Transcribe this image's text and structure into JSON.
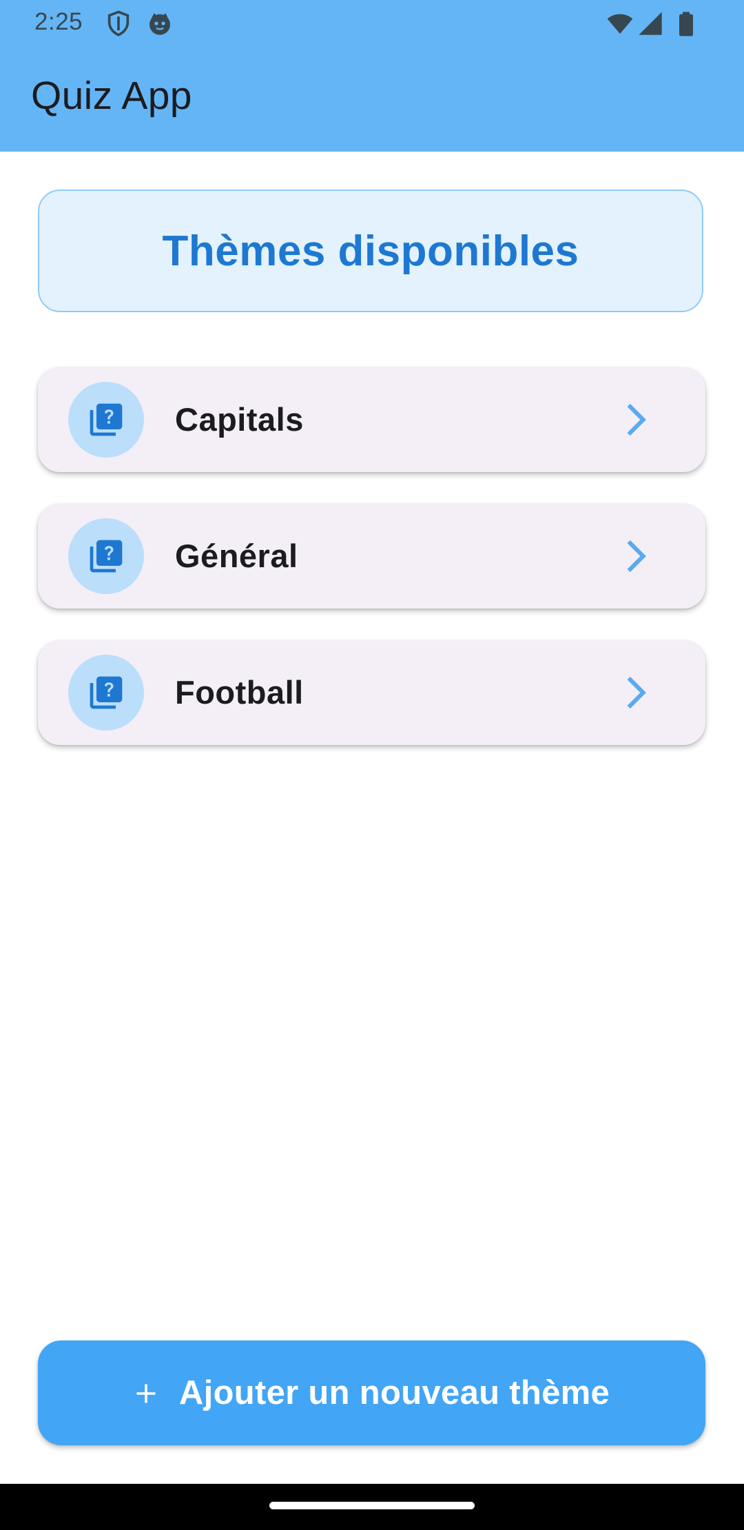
{
  "status_bar": {
    "time": "2:25",
    "left_icons": [
      "shield-icon",
      "face-icon"
    ],
    "right_icons": [
      "wifi-icon",
      "signal-icon",
      "battery-icon"
    ]
  },
  "app_bar": {
    "title": "Quiz App",
    "color": "#64b5f6"
  },
  "header": {
    "title": "Thèmes disponibles"
  },
  "themes": [
    {
      "label": "Capitals",
      "icon": "quiz-icon",
      "trailing_icon": "chevron-right-icon"
    },
    {
      "label": "Général",
      "icon": "quiz-icon",
      "trailing_icon": "chevron-right-icon"
    },
    {
      "label": "Football",
      "icon": "quiz-icon",
      "trailing_icon": "chevron-right-icon"
    }
  ],
  "add_button": {
    "label": "Ajouter un nouveau thème",
    "icon": "plus-icon",
    "color": "#42a5f5"
  },
  "colors": {
    "accent": "#1e78d2",
    "card_background": "#f4eff7",
    "header_background": "#e3f2fd"
  }
}
